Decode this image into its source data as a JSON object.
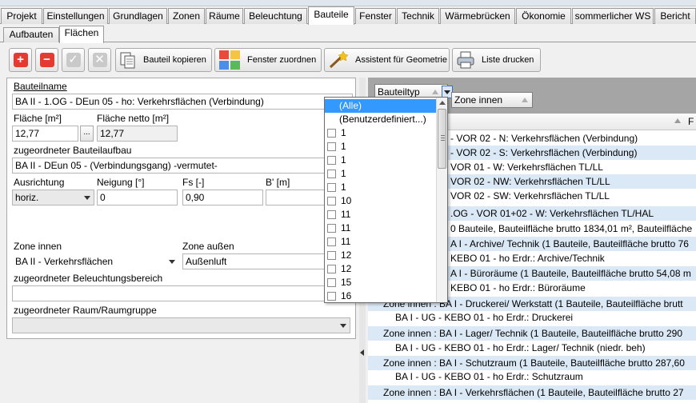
{
  "main_tabs": [
    {
      "label": "Projekt"
    },
    {
      "label": "Einstellungen"
    },
    {
      "label": "Grundlagen"
    },
    {
      "label": "Zonen"
    },
    {
      "label": "Räume"
    },
    {
      "label": "Beleuchtung"
    },
    {
      "label": "Bauteile"
    },
    {
      "label": "Fenster"
    },
    {
      "label": "Technik"
    },
    {
      "label": "Wärmebrücken"
    },
    {
      "label": "Ökonomie"
    },
    {
      "label": "sommerlicher WS"
    },
    {
      "label": "Bericht"
    }
  ],
  "active_main_tab": "Bauteile",
  "sub_tabs": [
    {
      "label": "Aufbauten"
    },
    {
      "label": "Flächen"
    }
  ],
  "active_sub_tab": "Flächen",
  "toolbar": {
    "add_icon": "plus-icon",
    "remove_icon": "minus-icon",
    "confirm_icon": "check-icon",
    "cancel_icon": "x-icon",
    "copy_label": "Bauteil kopieren",
    "assign_window_label": "Fenster zuordnen",
    "geometry_label": "Assistent für Geometrie",
    "print_label": "Liste drucken"
  },
  "form": {
    "name_label": "Bauteilname",
    "name_value": "BA II - 1.OG - DEun 05 - ho: Verkehrsflächen (Verbindung)",
    "area_label": "Fläche [m²]",
    "area_value": "12,77",
    "area_btn": "...",
    "net_area_label": "Fläche netto [m²]",
    "net_area_value": "12,77",
    "construction_label": "zugeordneter Bauteilaufbau",
    "construction_value": "BA II - DEun 05 - (Verbindungsgang) -vermutet-",
    "orientation_label": "Ausrichtung",
    "orientation_value": "horiz.",
    "tilt_label": "Neigung [°]",
    "tilt_value": "0",
    "fs_label": "Fs [-]",
    "fs_value": "0,90",
    "b_label": "B' [m]",
    "b_value": "",
    "zone_inner_label": "Zone innen",
    "zone_inner_value": "BA II - Verkehrsflächen",
    "zone_outer_label": "Zone außen",
    "zone_outer_value": "Außenluft",
    "lighting_label": "zugeordneter Beleuchtungsbereich",
    "lighting_value": "",
    "room_label": "zugeordneter Raum/Raumgruppe",
    "room_value": ""
  },
  "grid": {
    "group_chip_1": "Bauteiltyp",
    "group_chip_2": "Zone innen",
    "column_partial": "F",
    "rows": [
      {
        "text": "- VOR 02 - N: Verkehrsflächen (Verbindung)"
      },
      {
        "text": "- VOR 02 - S: Verkehrsflächen (Verbindung)"
      },
      {
        "text": "VOR 01 - W: Verkehrsflächen TL/LL"
      },
      {
        "text": "VOR 02 - NW: Verkehrsflächen TL/LL"
      },
      {
        "text": "VOR 02 - SW: Verkehrsflächen TL/LL"
      },
      {
        "text": ".OG - VOR 01+02 - W: Verkehrsflächen TL/HAL"
      },
      {
        "text": "0 Bauteile, Bauteilfläche brutto 1834,01 m², Bauteilfläche"
      },
      {
        "text": "A I - Archive/ Technik (1 Bauteile, Bauteilfläche brutto 76"
      },
      {
        "text": "KEBO 01 - ho Erdr.: Archive/Technik"
      },
      {
        "text": "A I - Büroräume (1 Bauteile, Bauteilfläche brutto 54,08 m"
      },
      {
        "text": "KEBO 01 - ho Erdr.: Büroräume"
      },
      {
        "text": "Zone innen : BA I - Druckerei/ Werkstatt (1 Bauteile, Bauteilfläche brutt"
      },
      {
        "text": "BA I - UG - KEBO 01 - ho Erdr.: Druckerei"
      },
      {
        "text": "Zone innen : BA I - Lager/ Technik (1 Bauteile, Bauteilfläche brutto 290"
      },
      {
        "text": "BA I - UG - KEBO 01 - ho Erdr.: Lager/ Technik (niedr. beh)"
      },
      {
        "text": "Zone innen : BA I - Schutzraum (1 Bauteile, Bauteilfläche brutto 287,60"
      },
      {
        "text": "BA I - UG - KEBO 01 - ho Erdr.: Schutzraum"
      },
      {
        "text": "Zone innen : BA I - Verkehrsflächen (1 Bauteile, Bauteilfläche brutto 27"
      }
    ]
  },
  "filter_dropdown": {
    "items": [
      {
        "label": "(Alle)"
      },
      {
        "label": "(Benutzerdefiniert...)"
      },
      {
        "label": "1"
      },
      {
        "label": "1"
      },
      {
        "label": "1"
      },
      {
        "label": "1"
      },
      {
        "label": "1"
      },
      {
        "label": "10"
      },
      {
        "label": "11"
      },
      {
        "label": "11"
      },
      {
        "label": "11"
      },
      {
        "label": "12"
      },
      {
        "label": "12"
      },
      {
        "label": "15"
      },
      {
        "label": "16"
      }
    ],
    "selected_index": 0
  }
}
